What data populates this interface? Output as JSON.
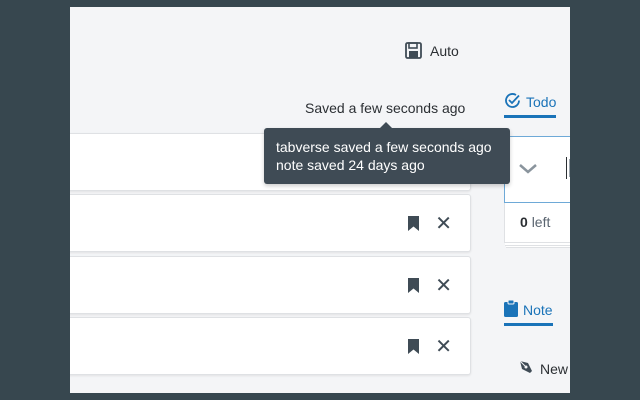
{
  "header": {
    "autosave_label": "Auto",
    "saved_status": "Saved a few seconds ago"
  },
  "tooltip": {
    "lines": [
      "tabverse saved a few seconds ago",
      "note saved 24 days ago"
    ]
  },
  "tabs": {
    "todo_label": "Todo",
    "note_label": "Note"
  },
  "todo": {
    "count": "0",
    "left_label": "left"
  },
  "note": {
    "new_label": "New"
  },
  "colors": {
    "accent": "#1a73b8",
    "frame": "#37474f",
    "tooltip_bg": "#3f4b55"
  }
}
